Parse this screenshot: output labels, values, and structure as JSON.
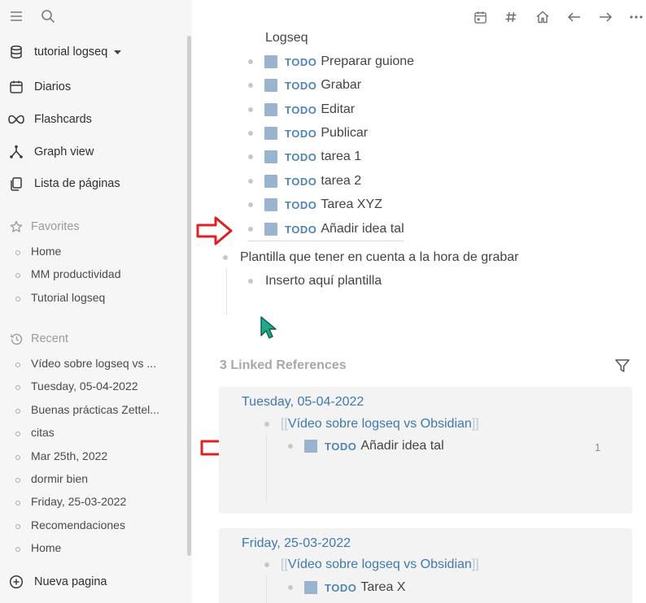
{
  "sidebar": {
    "graph_name": "tutorial logseq",
    "nav": [
      {
        "label": "Diarios",
        "icon": "calendar-icon"
      },
      {
        "label": "Flashcards",
        "icon": "infinity-icon"
      },
      {
        "label": "Graph view",
        "icon": "graph-icon"
      },
      {
        "label": "Lista de páginas",
        "icon": "pages-icon"
      }
    ],
    "favorites_label": "Favorites",
    "favorites": [
      "Home",
      "MM productividad",
      "Tutorial logseq"
    ],
    "recent_label": "Recent",
    "recent": [
      "Vídeo sobre logseq vs ...",
      "Tuesday, 05-04-2022",
      "Buenas prácticas Zettel...",
      "citas",
      "Mar 25th, 2022",
      "dormir bien",
      "Friday, 25-03-2022",
      "Recomendaciones",
      "Home"
    ],
    "new_page_label": "Nueva pagina"
  },
  "topbar": {
    "icons": [
      "calendar-icon",
      "hash-icon",
      "home-icon",
      "back-arrow-icon",
      "forward-arrow-icon",
      "more-icon"
    ]
  },
  "main": {
    "partial_title": "Logseq",
    "todo_marker": "TODO",
    "todos": [
      "Preparar guione",
      "Grabar",
      "Editar",
      "Publicar",
      "tarea 1",
      "tarea 2",
      "Tarea XYZ",
      "Añadir idea tal"
    ],
    "template_block": "Plantilla que tener en cuenta a la hora de grabar",
    "template_child": "Inserto aquí plantilla"
  },
  "references": {
    "title": "3 Linked References",
    "cards": [
      {
        "date": "Tuesday, 05-04-2022",
        "link": "Vídeo sobre logseq vs Obsidian",
        "todo": "Añadir idea tal",
        "count": "1"
      },
      {
        "date": "Friday, 25-03-2022",
        "link": "Vídeo sobre logseq vs Obsidian",
        "todo": "Tarea X"
      }
    ]
  },
  "colors": {
    "accent": "#3e79b0",
    "todo": "#4f84b5",
    "checkbox": "#9ab4d0",
    "arrow": "#e02020",
    "cursor": "#1fa88a"
  }
}
